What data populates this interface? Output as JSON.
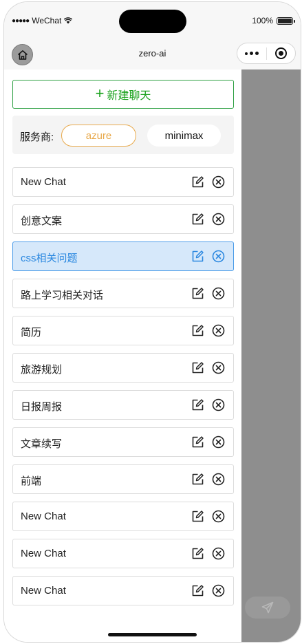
{
  "status_bar": {
    "signal": "●●●●●",
    "carrier": "WeChat",
    "battery": "100%"
  },
  "nav": {
    "title": "zero-ai",
    "icons": {
      "home": "home-icon",
      "more": "more-dots-icon",
      "close": "target-close-icon"
    }
  },
  "drawer": {
    "new_chat_label": "新建聊天",
    "provider_label": "服务商:",
    "providers": [
      {
        "label": "azure",
        "selected": true
      },
      {
        "label": "minimax",
        "selected": false
      }
    ],
    "chats": [
      {
        "title": "New Chat",
        "active": false
      },
      {
        "title": "创意文案",
        "active": false
      },
      {
        "title": "css相关问题",
        "active": true
      },
      {
        "title": "路上学习相关对话",
        "active": false
      },
      {
        "title": "简历",
        "active": false
      },
      {
        "title": "旅游规划",
        "active": false
      },
      {
        "title": "日报周报",
        "active": false
      },
      {
        "title": "文章续写",
        "active": false
      },
      {
        "title": "前端",
        "active": false
      },
      {
        "title": "New Chat",
        "active": false
      },
      {
        "title": "New Chat",
        "active": false
      },
      {
        "title": "New Chat",
        "active": false
      }
    ]
  },
  "colors": {
    "accent_green": "#18a11b",
    "azure_orange": "#e8a94b",
    "active_blue": "#2b88e0",
    "active_bg": "#d6e8fa",
    "overlay": "#8e8e8e"
  }
}
